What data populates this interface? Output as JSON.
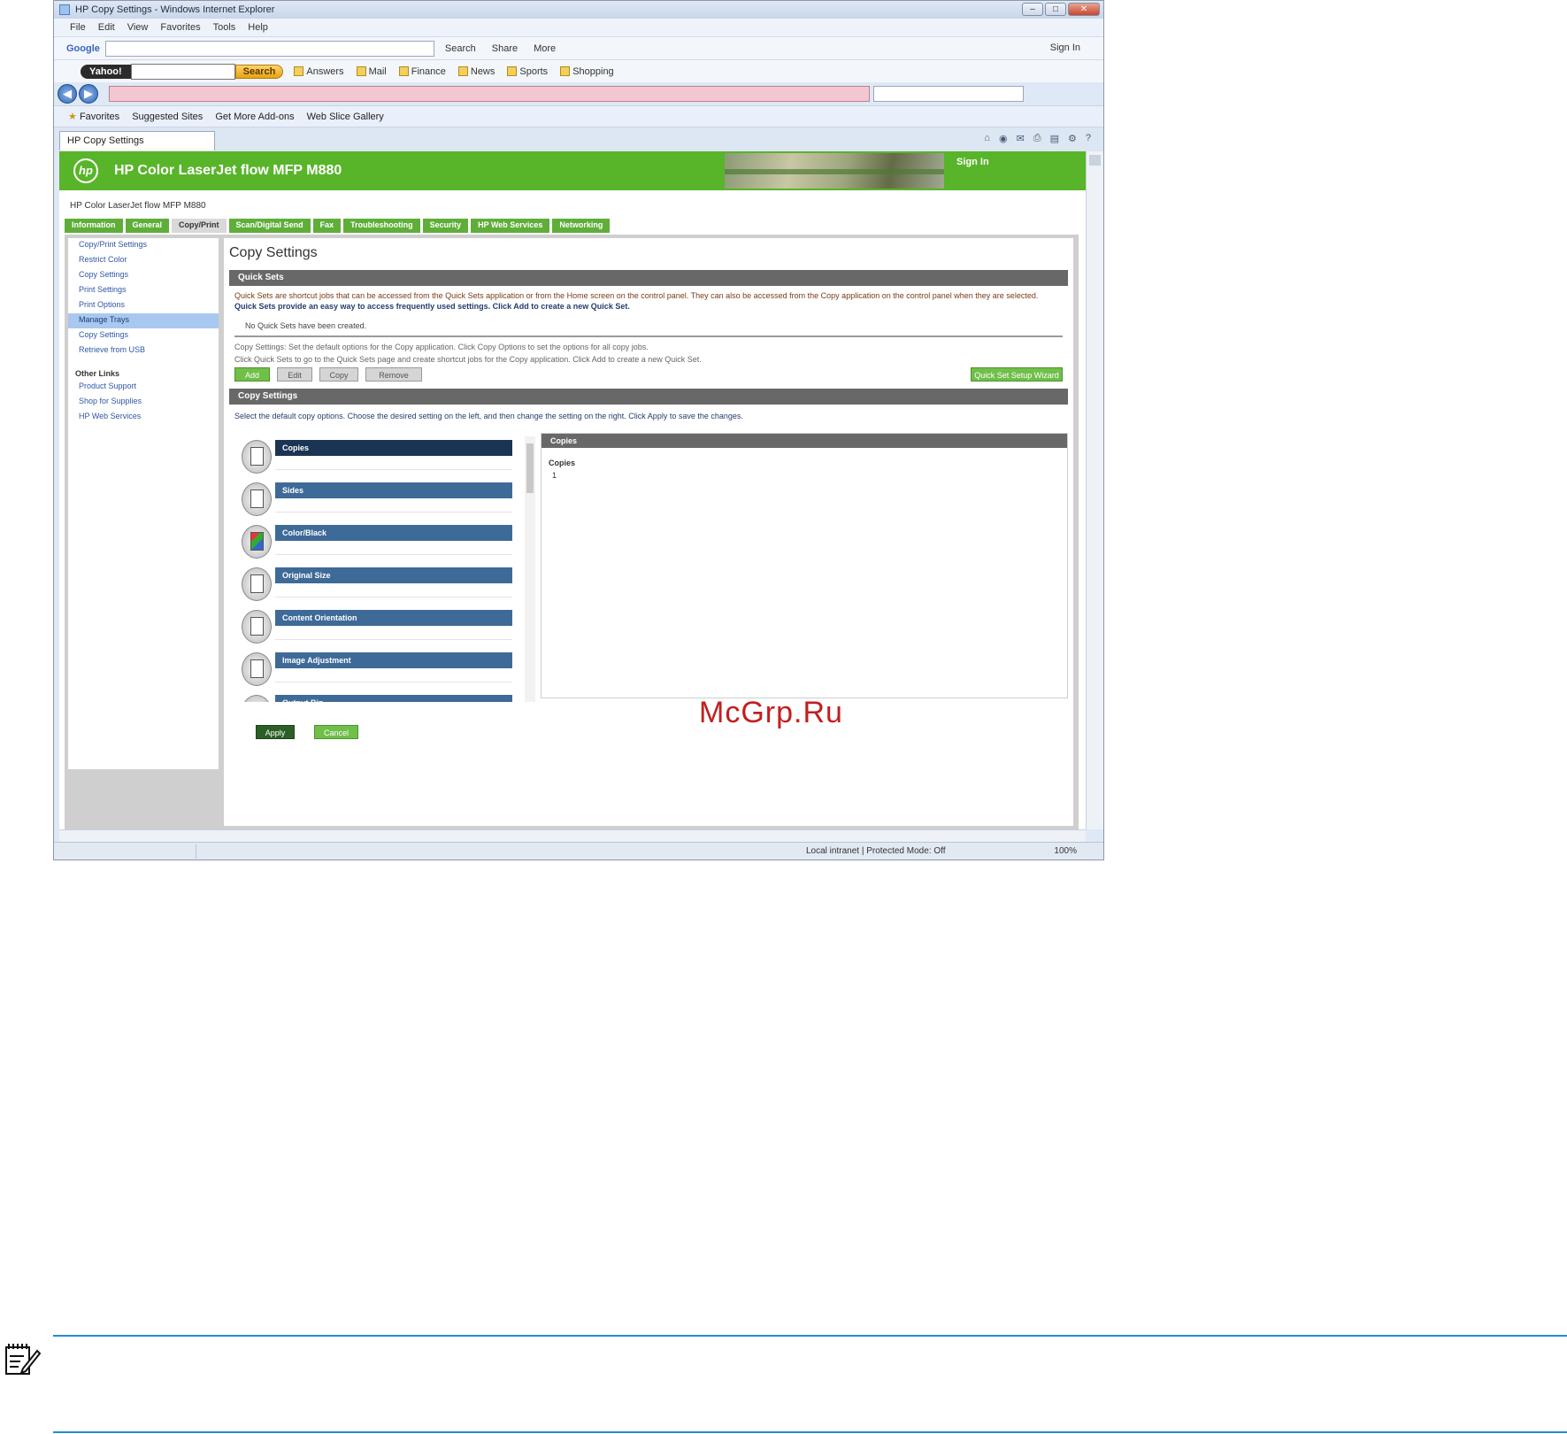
{
  "browser": {
    "window_title": "HP Copy Settings - Windows Internet Explorer",
    "menu": [
      "File",
      "Edit",
      "View",
      "Favorites",
      "Tools",
      "Help"
    ],
    "google_label": "Google",
    "google_items": [
      "Search",
      "Share",
      "More"
    ],
    "google_signin": "Sign In",
    "yahoo_button": "Yahoo!",
    "yahoo_search": "Search",
    "yahoo_links": [
      "Answers",
      "Mail",
      "Finance",
      "News",
      "Sports",
      "Shopping"
    ],
    "favorites_label": "Favorites",
    "favorites_links": [
      "Suggested Sites",
      "Get More Add-ons",
      "Web Slice Gallery"
    ],
    "tab_title": "HP Copy Settings",
    "status_zone": "Local intranet | Protected Mode: Off",
    "status_zoom": "100%"
  },
  "hp": {
    "product_title": "HP Color LaserJet flow MFP M880",
    "user": "Sign In",
    "device_line": "HP Color LaserJet flow MFP M880",
    "tabs": [
      "Information",
      "General",
      "Copy/Print",
      "Scan/Digital Send",
      "Fax",
      "Troubleshooting",
      "Security",
      "HP Web Services",
      "Networking"
    ],
    "left_nav": [
      "Copy/Print Settings",
      "Restrict Color",
      "Copy Settings",
      "Print Settings",
      "Print Options",
      "Manage Trays",
      "Copy Settings",
      "Retrieve from USB"
    ],
    "left_nav_selected": 5,
    "left_head": "Other Links",
    "left_links": [
      "Product Support",
      "Shop for Supplies",
      "HP Web Services"
    ],
    "page_title": "Copy Settings",
    "quick_sets_title": "Quick Sets",
    "quick_sets_text1": "Quick Sets are shortcut jobs that can be accessed from the Quick Sets application or from the Home screen on the control panel. They can also be accessed from the Copy application on the control panel when they are selected.",
    "quick_sets_text2": "Quick Sets provide an easy way to access frequently used settings. Click Add to create a new Quick Set.",
    "quick_sets_none": "No Quick Sets have been created.",
    "note_line1": "Copy Settings: Set the default options for the Copy application. Click Copy Options to set the options for all copy jobs.",
    "note_line2": "Click Quick Sets to go to the Quick Sets page and create shortcut jobs for the Copy application. Click Add to create a new Quick Set.",
    "qs_buttons": [
      "Add",
      "Edit",
      "Copy",
      "Remove"
    ],
    "qs_right_button": "Quick Set Setup Wizard",
    "copy_settings_title": "Copy Settings",
    "copy_settings_hint": "Select the default copy options. Choose the desired setting on the left, and then change the setting on the right. Click Apply to save the changes.",
    "settings": [
      "Copies",
      "Sides",
      "Color/Black",
      "Original Size",
      "Content Orientation",
      "Image Adjustment",
      "Output Bin"
    ],
    "details_title": "Copies",
    "details_label": "Copies",
    "details_value": "1",
    "apply_button": "Apply",
    "cancel_button": "Cancel"
  },
  "watermark": "McGrp.Ru",
  "colors": {
    "hp_green": "#58b52a",
    "selected_row": "#1c3454",
    "row": "#3e6a98",
    "note_rule": "#1f8dd6"
  }
}
